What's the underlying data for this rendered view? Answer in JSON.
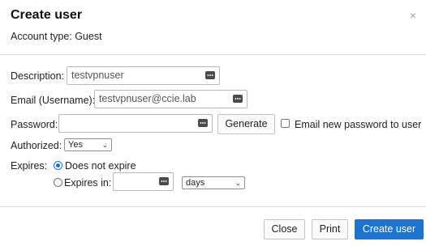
{
  "dialog": {
    "title": "Create user",
    "close_glyph": "×",
    "subtitle": "Account type: Guest"
  },
  "form": {
    "description_label": "Description:",
    "description_value": "testvpnuser",
    "email_label": "Email (Username):",
    "email_value": "testvpnuser@ccie.lab",
    "password_label": "Password:",
    "password_value": "",
    "generate_label": "Generate",
    "email_password_label": "Email new password to user",
    "email_password_checked": false,
    "authorized_label": "Authorized:",
    "authorized_value": "Yes",
    "expires_label": "Expires:",
    "does_not_expire_label": "Does not expire",
    "does_not_expire_selected": true,
    "expires_in_label": "Expires in:",
    "expires_in_value": "",
    "expires_unit_value": "days"
  },
  "footer": {
    "close_label": "Close",
    "print_label": "Print",
    "create_label": "Create user"
  },
  "colors": {
    "primary": "#1a73d1",
    "border": "#b9b9b9",
    "divider": "#dcdcdc"
  },
  "icons": {
    "password_manager": "password-dots-icon",
    "dropdown": "chevron-down-icon",
    "close": "close-icon"
  }
}
